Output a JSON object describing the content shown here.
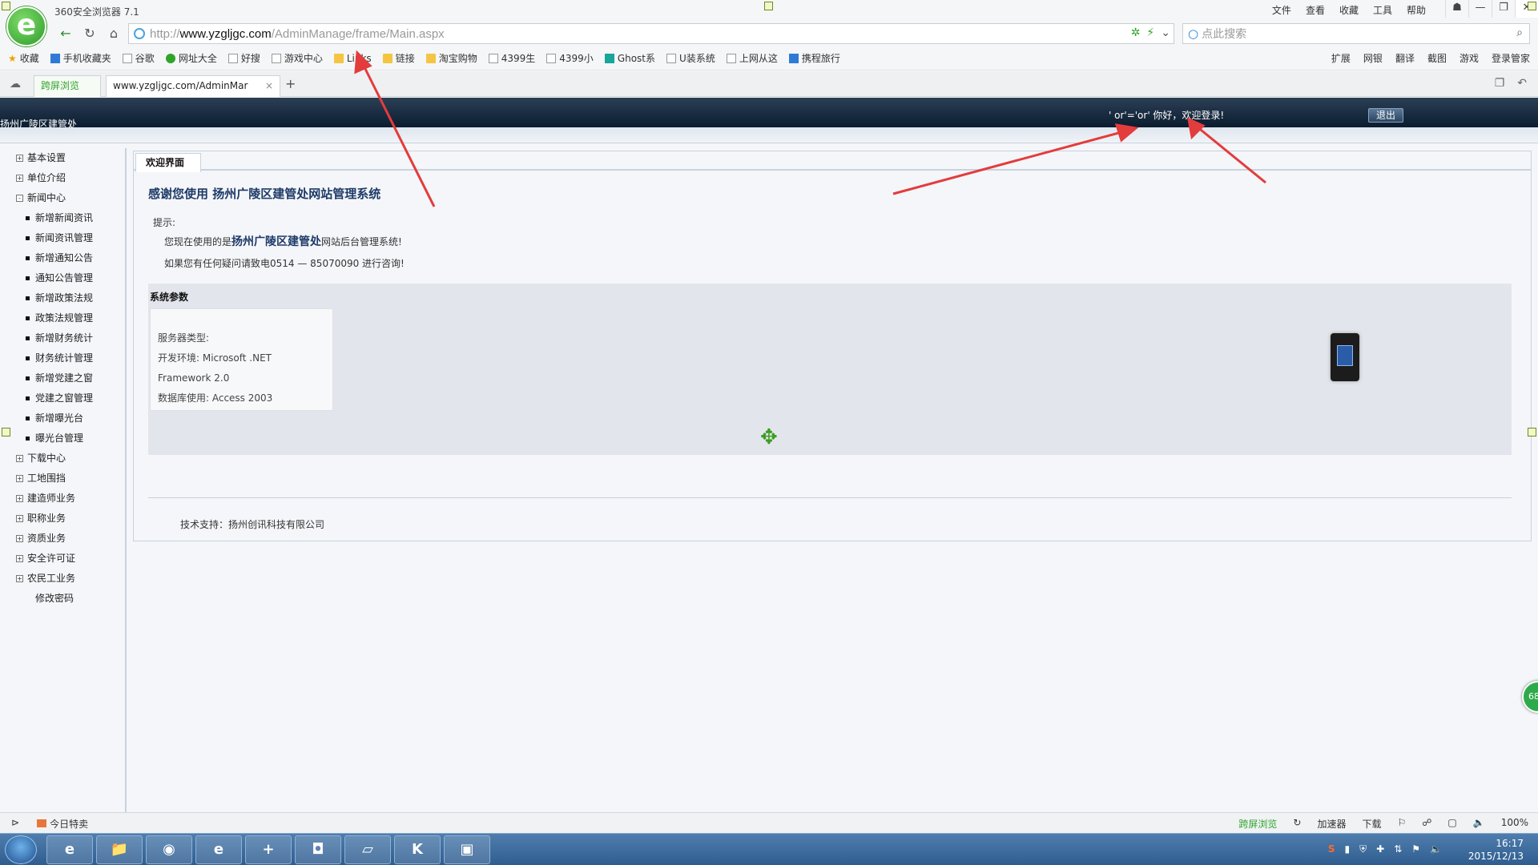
{
  "browser": {
    "app_title": "360安全浏览器 7.1",
    "menu": [
      "文件",
      "查看",
      "收藏",
      "工具",
      "帮助"
    ],
    "url_prefix": "http://",
    "url_host": "www.yzgljgc.com",
    "url_path": "/AdminManage/frame/Main.aspx",
    "search_placeholder": "点此搜索",
    "bookmarks": [
      {
        "label": "收藏",
        "icon": "star"
      },
      {
        "label": "手机收藏夹",
        "icon": "phone"
      },
      {
        "label": "谷歌",
        "icon": "page"
      },
      {
        "label": "网址大全",
        "icon": "green"
      },
      {
        "label": "好搜",
        "icon": "page"
      },
      {
        "label": "游戏中心",
        "icon": "page"
      },
      {
        "label": "Links",
        "icon": "folder"
      },
      {
        "label": "链接",
        "icon": "folder"
      },
      {
        "label": "淘宝购物",
        "icon": "folder"
      },
      {
        "label": "4399生",
        "icon": "page"
      },
      {
        "label": "4399小",
        "icon": "page"
      },
      {
        "label": "Ghost系",
        "icon": "teal"
      },
      {
        "label": "U装系统",
        "icon": "page"
      },
      {
        "label": "上网从这",
        "icon": "page"
      },
      {
        "label": "携程旅行",
        "icon": "blue"
      }
    ],
    "bookmarks_right": [
      "扩展",
      "网银",
      "翻译",
      "截图",
      "游戏",
      "登录管家"
    ],
    "tab_split": "跨屏浏览",
    "tab_main": "www.yzgljgc.com/AdminMar",
    "tab_close": "×",
    "tab_add": "+"
  },
  "site": {
    "header_title": "扬州广陵区建管处",
    "welcome": "' or'='or'  你好，欢迎登录!",
    "logout": "退出"
  },
  "sidebar": [
    {
      "label": "基本设置",
      "kind": "top",
      "mark": "+"
    },
    {
      "label": "单位介绍",
      "kind": "top",
      "mark": "+"
    },
    {
      "label": "新闻中心",
      "kind": "top",
      "mark": "-"
    },
    {
      "label": "新增新闻资讯",
      "kind": "sub"
    },
    {
      "label": "新闻资讯管理",
      "kind": "sub"
    },
    {
      "label": "新增通知公告",
      "kind": "sub"
    },
    {
      "label": "通知公告管理",
      "kind": "sub"
    },
    {
      "label": "新增政策法规",
      "kind": "sub"
    },
    {
      "label": "政策法规管理",
      "kind": "sub"
    },
    {
      "label": "新增财务统计",
      "kind": "sub"
    },
    {
      "label": "财务统计管理",
      "kind": "sub"
    },
    {
      "label": "新增党建之窗",
      "kind": "sub"
    },
    {
      "label": "党建之窗管理",
      "kind": "sub"
    },
    {
      "label": "新增曝光台",
      "kind": "sub"
    },
    {
      "label": "曝光台管理",
      "kind": "sub"
    },
    {
      "label": "下载中心",
      "kind": "top",
      "mark": "+"
    },
    {
      "label": "工地围挡",
      "kind": "top",
      "mark": "+"
    },
    {
      "label": "建造师业务",
      "kind": "top",
      "mark": "+"
    },
    {
      "label": "职称业务",
      "kind": "top",
      "mark": "+"
    },
    {
      "label": "资质业务",
      "kind": "top",
      "mark": "+"
    },
    {
      "label": "安全许可证",
      "kind": "top",
      "mark": "+"
    },
    {
      "label": "农民工业务",
      "kind": "top",
      "mark": "+"
    },
    {
      "label": "修改密码",
      "kind": "plain"
    }
  ],
  "main": {
    "tab_label": "欢迎界面",
    "title": "感谢您使用 扬州广陵区建管处网站管理系统",
    "tip_label": "提示:",
    "line1_prefix": "您现在使用的是",
    "line1_highlight": "扬州广陵区建管处",
    "line1_suffix": "网站后台管理系统!",
    "line2": "如果您有任何疑问请致电0514 — 85070090 进行咨询!",
    "sys_header": "系统参数",
    "sys_rows": [
      "服务器类型:",
      "开发环境:  Microsoft .NET Framework 2.0",
      "数据库使用:  Access 2003"
    ],
    "footer": "技术支持：扬州创讯科技有限公司"
  },
  "statusbar": {
    "deal": "今日特卖",
    "right": [
      {
        "label": "跨屏浏览",
        "accent": "#2ea42a"
      },
      {
        "label": "↻",
        "accent": ""
      },
      {
        "label": "加速器",
        "accent": ""
      },
      {
        "label": "下载",
        "accent": ""
      },
      {
        "label": "⚐",
        "accent": ""
      },
      {
        "label": "☍",
        "accent": ""
      },
      {
        "label": "▢",
        "accent": ""
      },
      {
        "label": "🔈",
        "accent": ""
      },
      {
        "label": "100%",
        "accent": ""
      }
    ]
  },
  "taskbar": {
    "date": "2015/12/13",
    "time": "16:17",
    "apps": [
      "e",
      "📁",
      "◉",
      "e",
      "+",
      "◘",
      "▱",
      "K",
      "▣"
    ]
  },
  "floating": {
    "ball_text": "68"
  },
  "colors": {
    "header_dark": "#0b1c30",
    "link_blue": "#1e3a68",
    "arrow_red": "#e33c3c",
    "accent_green": "#2ea42a"
  }
}
